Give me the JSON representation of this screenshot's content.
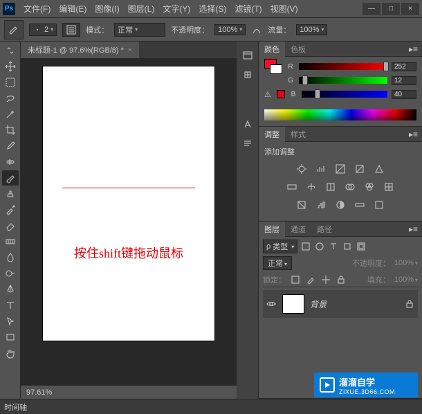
{
  "app": {
    "logo": "Ps"
  },
  "menu": [
    "文件(F)",
    "编辑(E)",
    "图像(I)",
    "图层(L)",
    "文字(Y)",
    "选择(S)",
    "滤镜(T)",
    "视图(V)"
  ],
  "win": {
    "min": "—",
    "max": "□",
    "close": "×"
  },
  "options": {
    "brush_size": "2",
    "mode_label": "模式：",
    "mode_value": "正常",
    "opacity_label": "不透明度：",
    "opacity_value": "100%",
    "flow_label": "流量：",
    "flow_value": "100%"
  },
  "doc": {
    "tab": "未标题-1 @ 97.6%(RGB/8) *",
    "canvas_text": "按住shift键拖动鼠标",
    "zoom": "97.61%",
    "timeline_tab": "时间轴"
  },
  "color_panel": {
    "tabs": [
      "颜色",
      "色板"
    ],
    "channels": [
      {
        "label": "R",
        "value": "252"
      },
      {
        "label": "G",
        "value": "12"
      },
      {
        "label": "B",
        "value": "40"
      }
    ],
    "warn": "⚠"
  },
  "adjust_panel": {
    "tabs": [
      "调整",
      "样式"
    ],
    "title": "添加调整"
  },
  "layers_panel": {
    "tabs": [
      "图层",
      "通道",
      "路径"
    ],
    "kind": "类型",
    "blend": "正常",
    "opacity_label": "不透明度：",
    "opacity_value": "100%",
    "lock_label": "锁定：",
    "fill_label": "填充：",
    "fill_value": "100%",
    "layer_name": "背景"
  },
  "watermark": {
    "name": "溜溜自学",
    "url": "ZIXUE.3D66.COM"
  }
}
